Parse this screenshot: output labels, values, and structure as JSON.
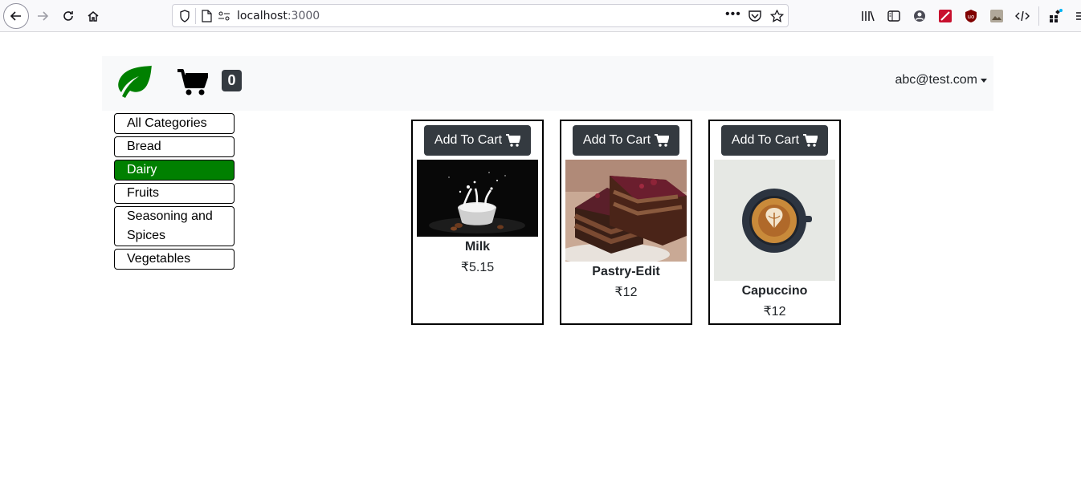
{
  "browser": {
    "url_host": "localhost",
    "url_port": ":3000"
  },
  "navbar": {
    "cart_count": "0",
    "user_email": "abc@test.com"
  },
  "categories": [
    {
      "label": "All Categories",
      "active": false
    },
    {
      "label": "Bread",
      "active": false
    },
    {
      "label": "Dairy",
      "active": true
    },
    {
      "label": "Fruits",
      "active": false
    },
    {
      "label": "Seasoning and Spices",
      "active": false
    },
    {
      "label": "Vegetables",
      "active": false
    }
  ],
  "products": [
    {
      "name": "Milk",
      "price": "₹5.15",
      "button": "Add To Cart"
    },
    {
      "name": "Pastry-Edit",
      "price": "₹12",
      "button": "Add To Cart"
    },
    {
      "name": "Capuccino",
      "price": "₹12",
      "button": "Add To Cart"
    }
  ],
  "colors": {
    "active_category": "#008000",
    "brand_leaf": "#008000",
    "dark_button": "#343a40"
  }
}
